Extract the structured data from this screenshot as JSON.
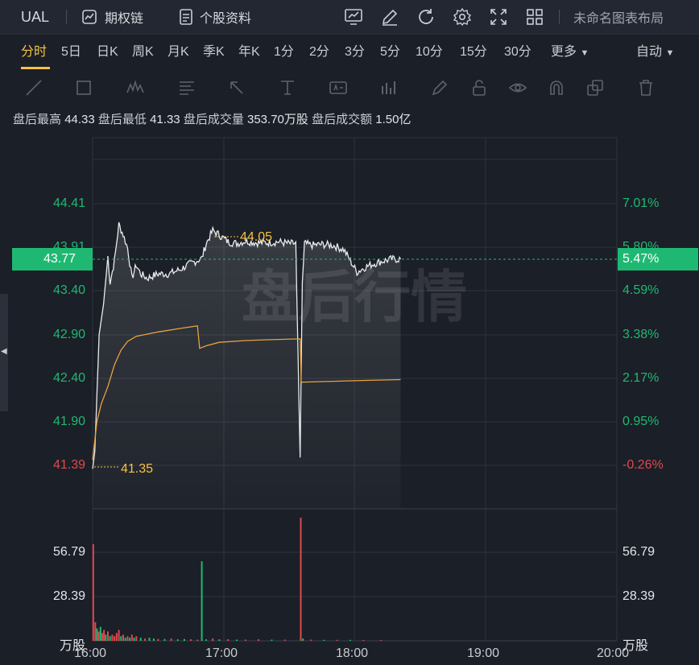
{
  "topbar": {
    "ticker": "UAL",
    "options_chain": "期权链",
    "stock_profile": "个股资料",
    "layout_name": "未命名图表布局"
  },
  "periods": [
    "分时",
    "5日",
    "日K",
    "周K",
    "月K",
    "季K",
    "年K",
    "1分",
    "2分",
    "3分",
    "5分",
    "10分",
    "15分",
    "30分"
  ],
  "more_label": "更多",
  "auto_label": "自动",
  "info": {
    "high_label": "盘后最高",
    "high": "44.33",
    "low_label": "盘后最低",
    "low": "41.33",
    "vol_label": "盘后成交量",
    "vol": "353.70万股",
    "amt_label": "盘后成交额",
    "amt": "1.50亿"
  },
  "price_axis": [
    "44.41",
    "43.91",
    "43.40",
    "42.90",
    "42.40",
    "41.90",
    "41.39"
  ],
  "pct_axis": [
    "7.01%",
    "5.80%",
    "4.59%",
    "3.38%",
    "2.17%",
    "0.95%",
    "-0.26%"
  ],
  "current_price": "43.77",
  "current_pct": "5.47%",
  "max_marker": "44.05",
  "min_marker": "41.35",
  "watermark": "盘后行情",
  "volume_axis": [
    "56.79",
    "28.39"
  ],
  "volume_unit": "万股",
  "time_axis": [
    "16:00",
    "17:00",
    "18:00",
    "19:00",
    "20:00"
  ],
  "colors": {
    "up": "#e0484f",
    "down": "#1fb873",
    "avg": "#e8a33c",
    "accent": "#f5c342",
    "price_line": "#e9ebee"
  }
}
